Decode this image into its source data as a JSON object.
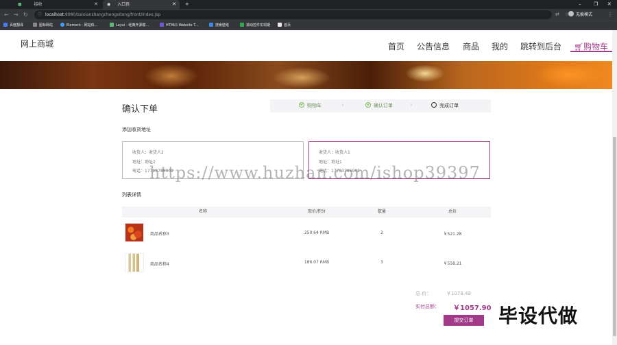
{
  "browser": {
    "tabs": [
      {
        "title": "",
        "active": false
      },
      {
        "title": "接收",
        "active": false
      },
      {
        "title": "入口页",
        "active": true
      }
    ],
    "new_tab": "+",
    "url_host": "localhost",
    "url_rest": ":8080/zaixianshangchengxitong/front/index.jsp",
    "profile": "无痕模式",
    "bookmarks": [
      {
        "label": "百度翻译",
        "color": "#4e7cf6"
      },
      {
        "label": "图标网站",
        "color": "#333"
      },
      {
        "label": "Element - 网站快...",
        "color": "#409eff"
      },
      {
        "label": "Layui - 经典开源模...",
        "color": "#5fb878"
      },
      {
        "label": "HTML5 Website T...",
        "color": "#6b57d8"
      },
      {
        "label": "搜索壁纸",
        "color": "#3b8be5"
      },
      {
        "label": "滚动控件实现期",
        "color": "#2fa84f"
      },
      {
        "label": "首页",
        "color": "#e8e8e8"
      }
    ]
  },
  "site": {
    "logo": "网上商城",
    "nav": [
      "首页",
      "公告信息",
      "商品",
      "我的",
      "跳转到后台"
    ],
    "cart": "购物车"
  },
  "order": {
    "title": "确认下单",
    "steps": [
      {
        "label": "购物车",
        "state": "done"
      },
      {
        "label": "确认订单",
        "state": "done"
      },
      {
        "label": "完成订单",
        "state": "todo"
      }
    ],
    "address_section": "添加收货地址",
    "addresses": [
      {
        "name": "收货人：收货人2",
        "addr": "地址：地址2",
        "phone": "电话：17703786902",
        "selected": false
      },
      {
        "name": "收货人：收货人1",
        "addr": "地址：地址1",
        "phone": "电话：17703786901",
        "selected": true
      }
    ],
    "list_section": "列表详情",
    "columns": [
      "名称",
      "现价/积分",
      "数量",
      "总价"
    ],
    "items": [
      {
        "name": "商品名称3",
        "price": "250.64 RMB",
        "qty": "2",
        "total": "￥521.28"
      },
      {
        "name": "商品名称4",
        "price": "186.07 RMB",
        "qty": "3",
        "total": "￥558.21"
      }
    ],
    "subtotal_label": "总    价：",
    "subtotal": "￥1079.49",
    "pay_label": "实付总额：",
    "pay_total": "￥1057.90",
    "submit": "提交订单"
  },
  "overlay": {
    "watermark": "https://www.huzhan.com/ishop39397",
    "stamp": "毕设代做"
  }
}
